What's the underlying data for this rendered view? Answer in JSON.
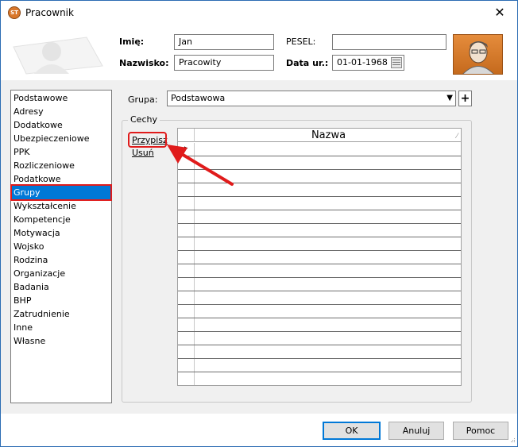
{
  "window": {
    "title": "Pracownik",
    "icon": "app-logo-icon",
    "close_glyph": "✕"
  },
  "header": {
    "imie_label": "Imię:",
    "imie_value": "Jan",
    "nazwisko_label": "Nazwisko:",
    "nazwisko_value": "Pracowity",
    "pesel_label": "PESEL:",
    "pesel_value": "",
    "data_label": "Data ur.:",
    "data_value": "01-01-1968"
  },
  "sidebar": {
    "items": [
      "Podstawowe",
      "Adresy",
      "Dodatkowe",
      "Ubezpieczeniowe",
      "PPK",
      "Rozliczeniowe",
      "Podatkowe",
      "Grupy",
      "Wykształcenie",
      "Kompetencje",
      "Motywacja",
      "Wojsko",
      "Rodzina",
      "Organizacje",
      "Badania",
      "BHP",
      "Zatrudnienie",
      "Inne",
      "Własne"
    ],
    "selected": "Grupy"
  },
  "grupa": {
    "label": "Grupa:",
    "value": "Podstawowa",
    "add_label": "+",
    "arrow": "▼"
  },
  "cechy": {
    "title": "Cechy",
    "assign_label": "Przypisz",
    "remove_label": "Usuń",
    "column_header": "Nazwa",
    "row_count": 18,
    "current_row_marker": "▸"
  },
  "buttons": {
    "ok": "OK",
    "cancel": "Anuluj",
    "help": "Pomoc"
  },
  "colors": {
    "selection": "#0078d7",
    "highlight": "#e01b1b",
    "accent_avatar": "#d9772b"
  }
}
